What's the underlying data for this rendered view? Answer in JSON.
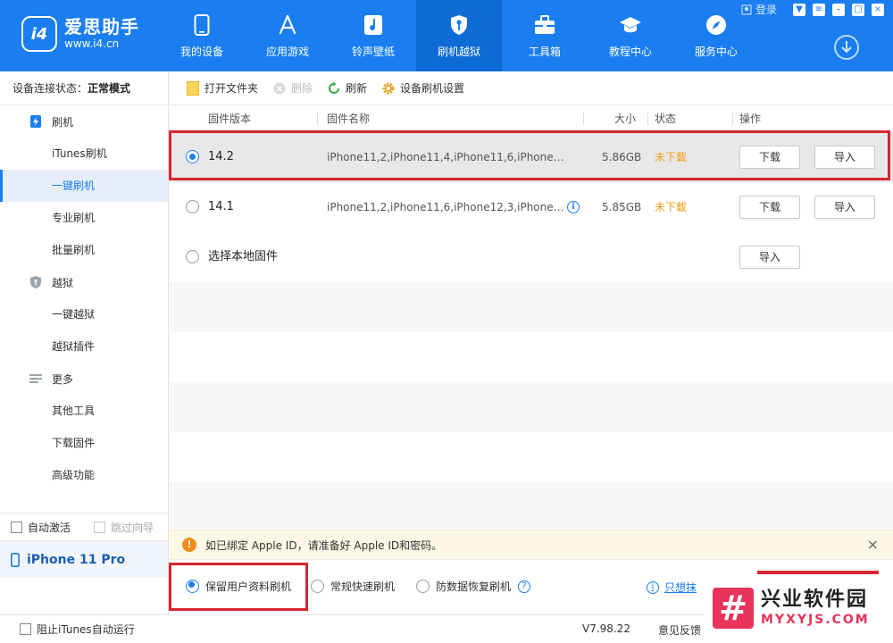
{
  "header": {
    "logo_name": "爱思助手",
    "logo_url": "www.i4.cn",
    "logo_badge": "i4",
    "login": "登录",
    "nav": [
      {
        "label": "我的设备",
        "icon": "phone-icon"
      },
      {
        "label": "应用游戏",
        "icon": "app-store-icon"
      },
      {
        "label": "铃声壁纸",
        "icon": "music-icon"
      },
      {
        "label": "刷机越狱",
        "icon": "shield-key-icon"
      },
      {
        "label": "工具箱",
        "icon": "toolbox-icon"
      },
      {
        "label": "教程中心",
        "icon": "graduation-icon"
      },
      {
        "label": "服务中心",
        "icon": "compass-icon"
      }
    ],
    "active_nav": "刷机越狱"
  },
  "sidebar": {
    "status_label": "设备连接状态：",
    "status_value": "正常模式",
    "groups": [
      {
        "label": "刷机",
        "icon": "flash-icon",
        "items": [
          "iTunes刷机",
          "一键刷机",
          "专业刷机",
          "批量刷机"
        ]
      },
      {
        "label": "越狱",
        "icon": "jailbreak-shield-icon",
        "items": [
          "一键越狱",
          "越狱插件"
        ]
      },
      {
        "label": "更多",
        "icon": "menu-lines-icon",
        "items": [
          "其他工具",
          "下载固件",
          "高级功能"
        ]
      }
    ],
    "active_item": "一键刷机",
    "auto_activate": "自动激活",
    "skip_guide": "跳过向导",
    "device_name": "iPhone 11 Pro"
  },
  "toolbar": {
    "open_folder": "打开文件夹",
    "delete": "删除",
    "refresh": "刷新",
    "settings": "设备刷机设置"
  },
  "table": {
    "headers": {
      "version": "固件版本",
      "name": "固件名称",
      "size": "大小",
      "status": "状态",
      "action": "操作"
    },
    "rows": [
      {
        "version": "14.2",
        "name": "iPhone11,2,iPhone11,4,iPhone11,6,iPhone12,...",
        "size": "5.86GB",
        "status": "未下載",
        "download": "下载",
        "import": "导入",
        "selected": true
      },
      {
        "version": "14.1",
        "name": "iPhone11,2,iPhone11,6,iPhone12,3,iPhone12,...",
        "size": "5.85GB",
        "status": "未下載",
        "download": "下载",
        "import": "导入",
        "selected": false
      },
      {
        "version": "选择本地固件",
        "import": "导入"
      }
    ]
  },
  "notice": {
    "text": "如已绑定 Apple ID，请准备好 Apple ID和密码。",
    "close": "×"
  },
  "modes": {
    "keep_data": "保留用户资料刷机",
    "quick": "常规快速刷机",
    "anti_recovery": "防数据恢复刷机",
    "help": "?",
    "only_link": "只想抹",
    "selected": "keep_data"
  },
  "statusbar": {
    "block_itunes": "阻止iTunes自动运行",
    "version": "V7.98.22",
    "feedback": "意见反馈"
  },
  "watermark": {
    "cn": "兴业软件园",
    "en": "MYXYJS.COM",
    "mark": "#"
  },
  "colors": {
    "brand": "#1a7ef0",
    "status_warn": "#f0a020",
    "highlight_box": "#d8262f"
  }
}
